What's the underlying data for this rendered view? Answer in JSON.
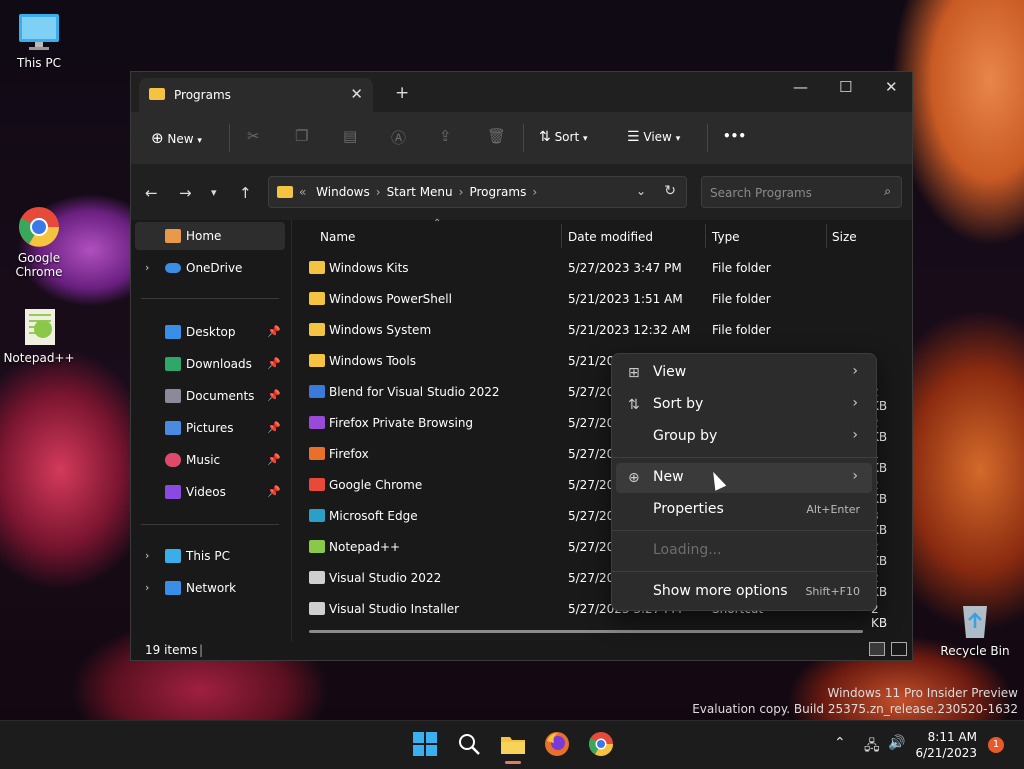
{
  "desktop": {
    "icons": [
      {
        "label": "This PC"
      },
      {
        "label": "Google Chrome"
      },
      {
        "label": "Notepad++"
      },
      {
        "label": "Recycle Bin"
      }
    ],
    "watermark": {
      "line1": "Windows 11 Pro Insider Preview",
      "line2": "Evaluation copy. Build 25375.zn_release.230520-1632"
    }
  },
  "window": {
    "tab_title": "Programs",
    "toolbar": {
      "new_label": "New",
      "sort_label": "Sort",
      "view_label": "View",
      "more_label": "•••"
    },
    "address": {
      "overflow": "«",
      "crumbs": [
        "Windows",
        "Start Menu",
        "Programs"
      ]
    },
    "search": {
      "placeholder": "Search Programs"
    },
    "nav": {
      "home": "Home",
      "onedrive": "OneDrive",
      "quick": [
        {
          "label": "Desktop",
          "color": "#3a8ee6"
        },
        {
          "label": "Downloads",
          "color": "#2ea86a"
        },
        {
          "label": "Documents",
          "color": "#8a8a9a"
        },
        {
          "label": "Pictures",
          "color": "#4a8ae0"
        },
        {
          "label": "Music",
          "color": "#e04a6a"
        },
        {
          "label": "Videos",
          "color": "#8a4ae0"
        }
      ],
      "thispc": "This PC",
      "network": "Network"
    },
    "columns": {
      "name": "Name",
      "date": "Date modified",
      "type": "Type",
      "size": "Size"
    },
    "files": [
      {
        "name": "Windows Kits",
        "date": "5/27/2023 3:47 PM",
        "type": "File folder",
        "size": "",
        "color": "#f4c341"
      },
      {
        "name": "Windows PowerShell",
        "date": "5/21/2023 1:51 AM",
        "type": "File folder",
        "size": "",
        "color": "#f4c341"
      },
      {
        "name": "Windows System",
        "date": "5/21/2023 12:32 AM",
        "type": "File folder",
        "size": "",
        "color": "#f4c341"
      },
      {
        "name": "Windows Tools",
        "date": "5/21/202",
        "type": "",
        "size": "",
        "color": "#f4c341"
      },
      {
        "name": "Blend for Visual Studio 2022",
        "date": "5/27/202",
        "type": "",
        "size": "2 KB",
        "color": "#3a7ad8"
      },
      {
        "name": "Firefox Private Browsing",
        "date": "5/27/202",
        "type": "",
        "size": "2 KB",
        "color": "#9a4ad8"
      },
      {
        "name": "Firefox",
        "date": "5/27/202",
        "type": "",
        "size": "1 KB",
        "color": "#e8702a"
      },
      {
        "name": "Google Chrome",
        "date": "5/27/202",
        "type": "",
        "size": "2 KB",
        "color": "#e84a3a"
      },
      {
        "name": "Microsoft Edge",
        "date": "5/27/202",
        "type": "",
        "size": "3 KB",
        "color": "#2aa0c8"
      },
      {
        "name": "Notepad++",
        "date": "5/27/202",
        "type": "",
        "size": "2 KB",
        "color": "#8ac84a"
      },
      {
        "name": "Visual Studio 2022",
        "date": "5/27/202",
        "type": "",
        "size": "2 KB",
        "color": "#cfcfcf"
      },
      {
        "name": "Visual Studio Installer",
        "date": "5/27/2023 3:27 PM",
        "type": "Shortcut",
        "size": "2 KB",
        "color": "#cfcfcf"
      }
    ],
    "status": {
      "count": "19 items"
    }
  },
  "context_menu": {
    "items": [
      {
        "label": "View",
        "icon": "⊞"
      },
      {
        "label": "Sort by",
        "icon": "⇅"
      },
      {
        "label": "Group by",
        "icon": ""
      },
      {
        "label": "New",
        "icon": "⊕"
      },
      {
        "label": "Properties",
        "icon": "",
        "shortcut": "Alt+Enter"
      },
      {
        "label": "Loading...",
        "icon": ""
      },
      {
        "label": "Show more options",
        "icon": "",
        "shortcut": "Shift+F10"
      }
    ]
  },
  "taskbar": {
    "time": "8:11 AM",
    "date": "6/21/2023",
    "notifications": "1"
  }
}
